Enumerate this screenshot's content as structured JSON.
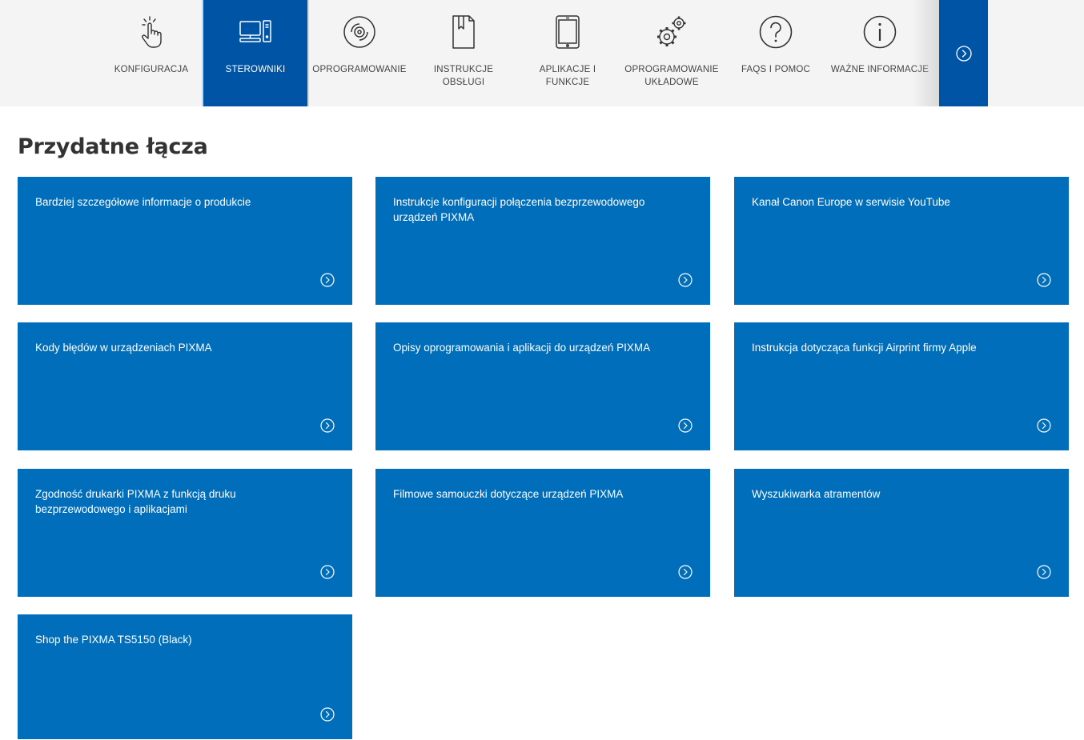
{
  "nav": {
    "items": [
      {
        "label": "KONFIGURACJA",
        "icon": "hand-pointer-icon",
        "active": false
      },
      {
        "label": "STEROWNIKI",
        "icon": "computer-icon",
        "active": true
      },
      {
        "label": "OPROGRAMOWANIE",
        "icon": "disc-icon",
        "active": false
      },
      {
        "label": "INSTRUKCJE OBSŁUGI",
        "icon": "manual-book-icon",
        "active": false
      },
      {
        "label": "APLIKACJE I FUNKCJE",
        "icon": "tablet-icon",
        "active": false
      },
      {
        "label": "OPROGRAMOWANIE UKŁADOWE",
        "icon": "gears-icon",
        "active": false
      },
      {
        "label": "FAQS I POMOC",
        "icon": "question-icon",
        "active": false
      },
      {
        "label": "WAŻNE INFORMACJE",
        "icon": "info-icon",
        "active": false
      }
    ],
    "next_icon": "chevron-right-circle-icon"
  },
  "section": {
    "title": "Przydatne łącza"
  },
  "links": [
    {
      "label": "Bardziej szczegółowe informacje o produkcie"
    },
    {
      "label": "Instrukcje konfiguracji połączenia bezprzewodowego urządzeń PIXMA"
    },
    {
      "label": "Kanał Canon Europe w serwisie YouTube"
    },
    {
      "label": "Kody błędów w urządzeniach PIXMA"
    },
    {
      "label": "Opisy oprogramowania i aplikacji do urządzeń PIXMA"
    },
    {
      "label": "Instrukcja dotycząca funkcji Airprint firmy Apple"
    },
    {
      "label": "Zgodność drukarki PIXMA z funkcją druku bezprzewodowego i aplikacjami"
    },
    {
      "label": "Filmowe samouczki dotyczące urządzeń PIXMA"
    },
    {
      "label": "Wyszukiwarka atramentów"
    },
    {
      "label": "Shop the PIXMA TS5150 (Black)"
    }
  ],
  "colors": {
    "nav_bg": "#f4f4f4",
    "nav_active": "#0054a6",
    "card_bg": "#006ebb",
    "icon_stroke": "#333333"
  }
}
